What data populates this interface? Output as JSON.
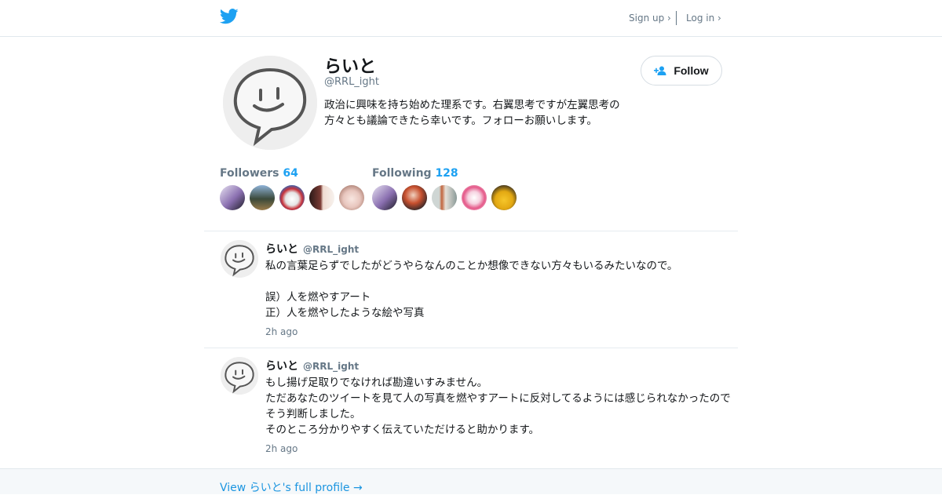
{
  "header": {
    "signup_label": "Sign up ›",
    "login_label": "Log in ›",
    "logo_icon": "twitter-bird-icon",
    "accent_color": "#1da1f2"
  },
  "profile": {
    "name": "らいと",
    "handle": "@RRL_ight",
    "bio": "政治に興味を持ち始めた理系です。右翼思考ですが左翼思考の方々とも議論できたら幸いです。フォローお願いします。",
    "follow_label": "Follow"
  },
  "stats": {
    "followers_label": "Followers",
    "followers_count": "64",
    "following_label": "Following",
    "following_count": "128"
  },
  "tweets": [
    {
      "name": "らいと",
      "handle": "@RRL_ight",
      "text": "私の言葉足らずでしたがどうやらなんのことか想像できない方々もいるみたいなので。\n\n誤）人を燃やすアート\n正）人を燃やしたような絵や写真",
      "time": "2h ago"
    },
    {
      "name": "らいと",
      "handle": "@RRL_ight",
      "text": "もし揚げ足取りでなければ勘違いすみません。\nただあなたのツイートを見て人の写真を燃やすアートに反対してるようには感じられなかったのでそう判断しました。\nそのところ分かりやすく伝えていただけると助かります。",
      "time": "2h ago"
    }
  ],
  "footer": {
    "link_label": "View らいと's full profile →"
  }
}
